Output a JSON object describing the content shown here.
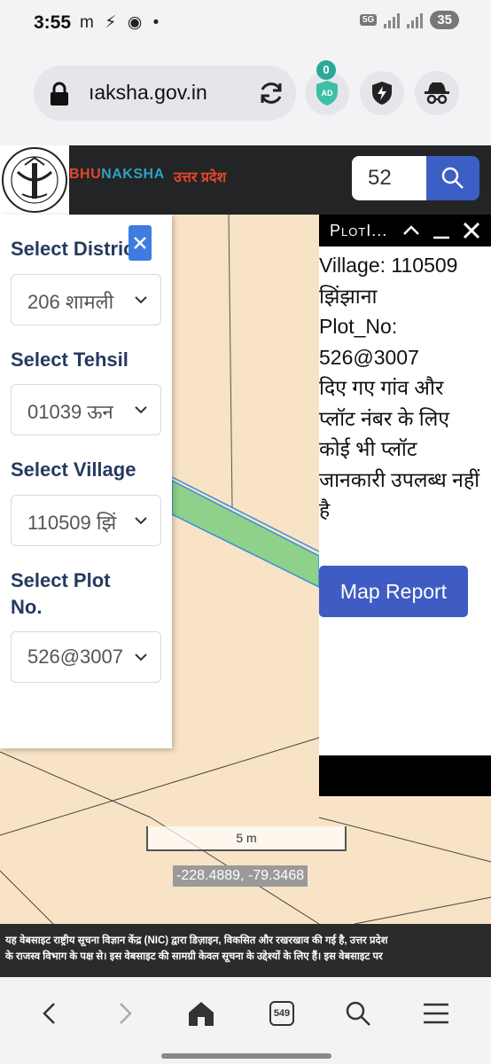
{
  "status_bar": {
    "time": "3:55",
    "left_icons": [
      "m",
      "⚡",
      "◉",
      "•"
    ],
    "network": "5G",
    "battery": "35"
  },
  "browser": {
    "url": "ıaksha.gov.in",
    "adblock_count": "0",
    "adblock_label": "AD",
    "icons": [
      "lock-icon",
      "reload-icon",
      "adblock-icon",
      "shield-bolt-icon",
      "incognito-icon"
    ]
  },
  "header": {
    "brand_part1": "BHU",
    "brand_part2": "NAKSHA",
    "state": "उत्तर प्रदेश",
    "search_value": "52"
  },
  "left_panel": {
    "district_label": "Select District",
    "district_value": "206 शामली",
    "tehsil_label": "Select Tehsil",
    "tehsil_value": "01039 ऊन",
    "village_label": "Select Village",
    "village_value": "110509 झिं",
    "plot_label_line1": "Select Plot",
    "plot_label_line2": "No.",
    "plot_value": "526@3007"
  },
  "plot_info": {
    "title": "PlotI...",
    "lines": [
      "Village: 110509",
      "झिंझाना",
      "Plot_No:",
      "526@3007",
      "दिए गए गांव और",
      "प्लॉट नंबर के लिए",
      "कोई भी प्लॉट",
      "जानकारी उपलब्ध नहीं",
      "है"
    ],
    "map_report_label": "Map Report"
  },
  "map": {
    "scale_label": "5 m",
    "coordinates": "-228.4889, -79.3468",
    "colors": {
      "background": "#f8e3c6",
      "plot_fill": "#8fd08a",
      "plot_edge": "#3a90d8"
    }
  },
  "disclaimer": {
    "line1": "यह वेबसाइट राष्ट्रीय सूचना विज्ञान केंद्र (NIC) द्वारा डिज़ाइन, विकसित और रखरखाव की गई है, उत्तर प्रदेश",
    "line2": "के राजस्व विभाग के पक्ष से। इस वेबसाइट की सामग्री केवल सूचना के उद्देश्यों के लिए हैं। इस वेबसाइट पर"
  },
  "bottom_nav": {
    "tab_count": "549",
    "icons": [
      "back-icon",
      "forward-icon",
      "home-icon",
      "tabs-icon",
      "search-icon",
      "menu-icon"
    ]
  }
}
